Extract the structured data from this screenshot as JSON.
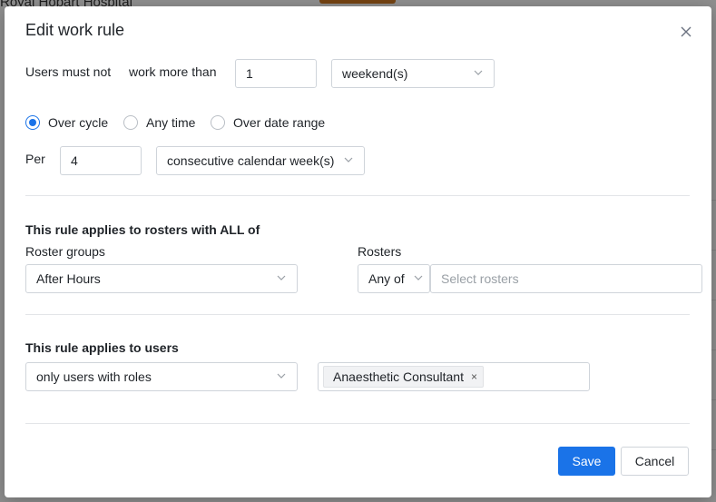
{
  "background": {
    "header_text": "Royal Hobart Hospital"
  },
  "modal": {
    "title": "Edit work rule",
    "rule": {
      "prefix_label": "Users must not",
      "verb_label": "work more than",
      "amount": "1",
      "unit": "weekend(s)"
    },
    "period": {
      "options": [
        {
          "label": "Over cycle",
          "checked": true
        },
        {
          "label": "Any time",
          "checked": false
        },
        {
          "label": "Over date range",
          "checked": false
        }
      ],
      "per_label": "Per",
      "per_value": "4",
      "per_unit": "consecutive calendar week(s)"
    },
    "rosters_section": {
      "title": "This rule applies to rosters with ALL of",
      "roster_groups_label": "Roster groups",
      "roster_groups_value": "After Hours",
      "rosters_label": "Rosters",
      "rosters_match": "Any of",
      "rosters_placeholder": "Select rosters"
    },
    "users_section": {
      "title": "This rule applies to users",
      "users_filter": "only users with roles",
      "roles": [
        "Anaesthetic Consultant"
      ]
    },
    "buttons": {
      "save": "Save",
      "cancel": "Cancel"
    }
  },
  "colors": {
    "primary": "#1a73e8",
    "bg_accent": "#c8741f"
  },
  "icons": {
    "close": "close-icon",
    "dropdown": "chevron-down-icon",
    "remove_tag": "close-icon"
  }
}
